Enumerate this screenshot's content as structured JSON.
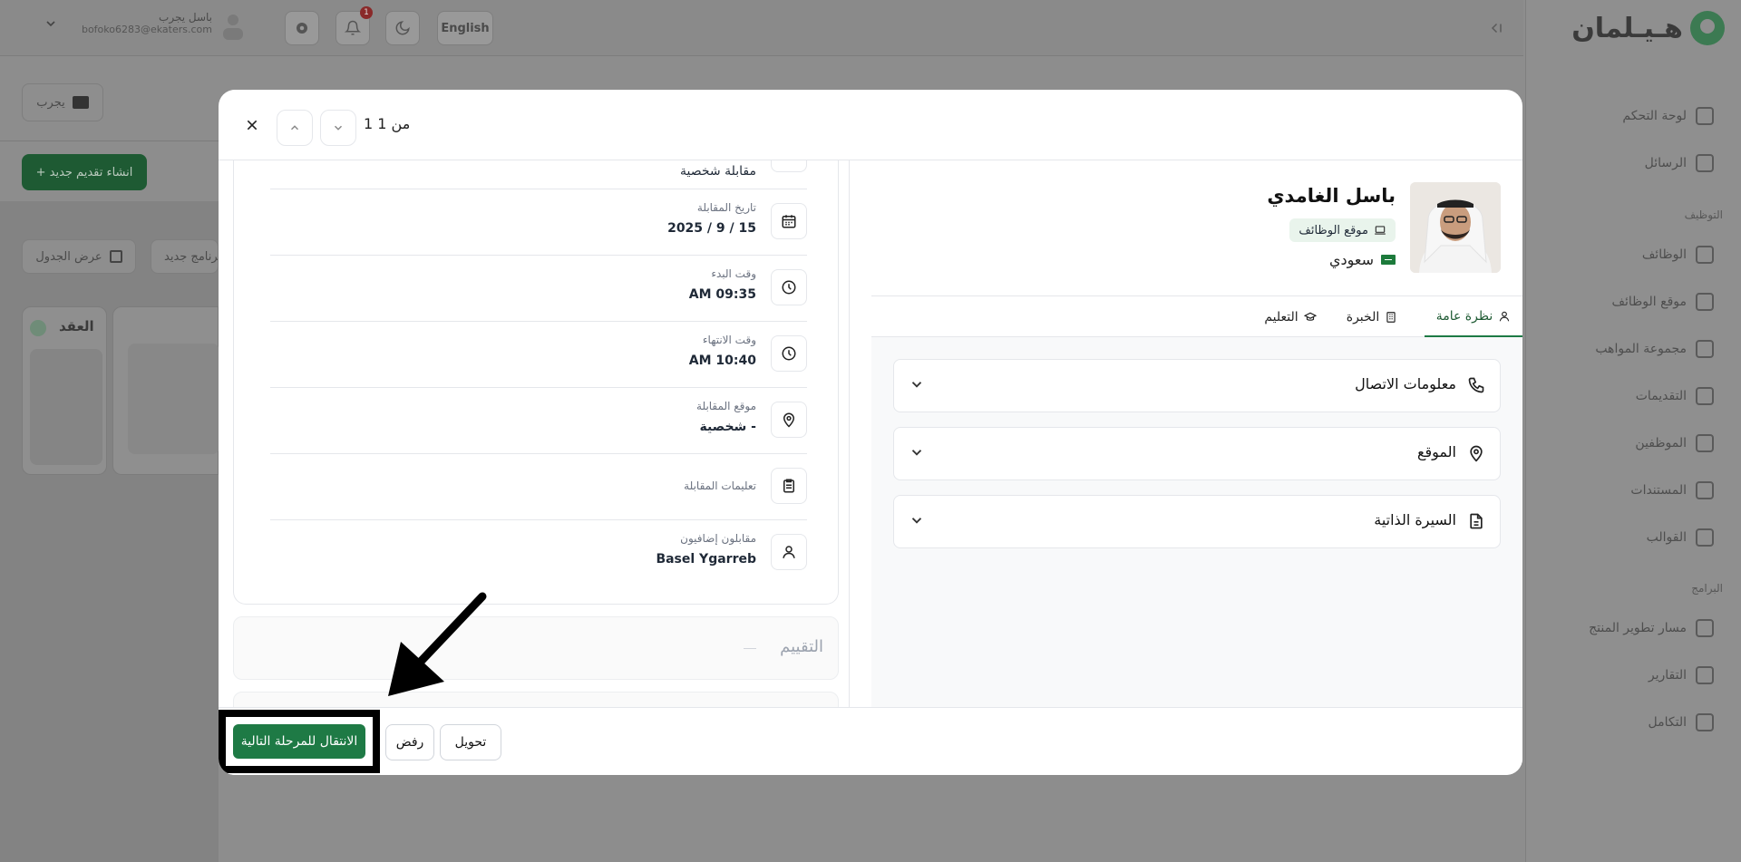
{
  "background": {
    "topbar": {
      "language_label": "English",
      "user_name": "باسل يجرب",
      "user_email": "bofoko6283@ekaters.com",
      "notification_count": "1"
    },
    "sidebar": {
      "logo_text": "هـيـلمان",
      "items_top": [
        "لوحة التحكم",
        "الرسائل"
      ],
      "section_jobs": "التوظيف",
      "items_jobs": [
        "الوظائف",
        "موقع الوظائف",
        "مجموعة المواهب",
        "التقديمات",
        "الموظفين",
        "المستندات",
        "القوالب"
      ],
      "section_programs": "البرامج",
      "items_programs": [
        "مسار تطوير المنتج",
        "التقارير",
        "التكامل"
      ]
    },
    "page": {
      "try_button": "يجرب",
      "create_button": "+ انشاء تقديم جديد",
      "table_view": "عرض الجدول",
      "new_schedule": "برنامج جديد",
      "column_title": "العقد"
    }
  },
  "modal": {
    "counter": "1 من 1",
    "interview": {
      "partial_value": "مقابلة شخصية",
      "rows": [
        {
          "label": "تاريخ المقابلة",
          "value": "2025 / 9 / 15",
          "icon": "calendar-icon"
        },
        {
          "label": "وقت البدء",
          "value": "AM 09:35",
          "icon": "clock-icon"
        },
        {
          "label": "وقت الانتهاء",
          "value": "AM 10:40",
          "icon": "clock-icon"
        },
        {
          "label": "موقع المقابلة",
          "value": "شخصية -",
          "icon": "map-pin-icon"
        },
        {
          "label": "تعليمات المقابلة",
          "value": "",
          "icon": "clipboard-icon"
        },
        {
          "label": "مقابلون إضافيون",
          "value": "Basel Ygarreb",
          "icon": "user-icon"
        }
      ]
    },
    "rating_title": "التقييم",
    "candidate": {
      "name": "باسل الغامدي",
      "source": "موقع الوظائف",
      "nationality": "سعودي"
    },
    "tabs": [
      "نظرة عامة",
      "الخبرة",
      "التعليم"
    ],
    "accordions": [
      "معلومات الاتصال",
      "الموقع",
      "السيرة الذاتية"
    ],
    "footer": {
      "next_stage": "الانتقال للمرحلة التالية",
      "reject": "رفض",
      "transfer": "تحويل"
    }
  },
  "colors": {
    "primary_green": "#1e7a45",
    "overlay_gray": "#8d8d8d",
    "annotation_black": "#000000"
  }
}
